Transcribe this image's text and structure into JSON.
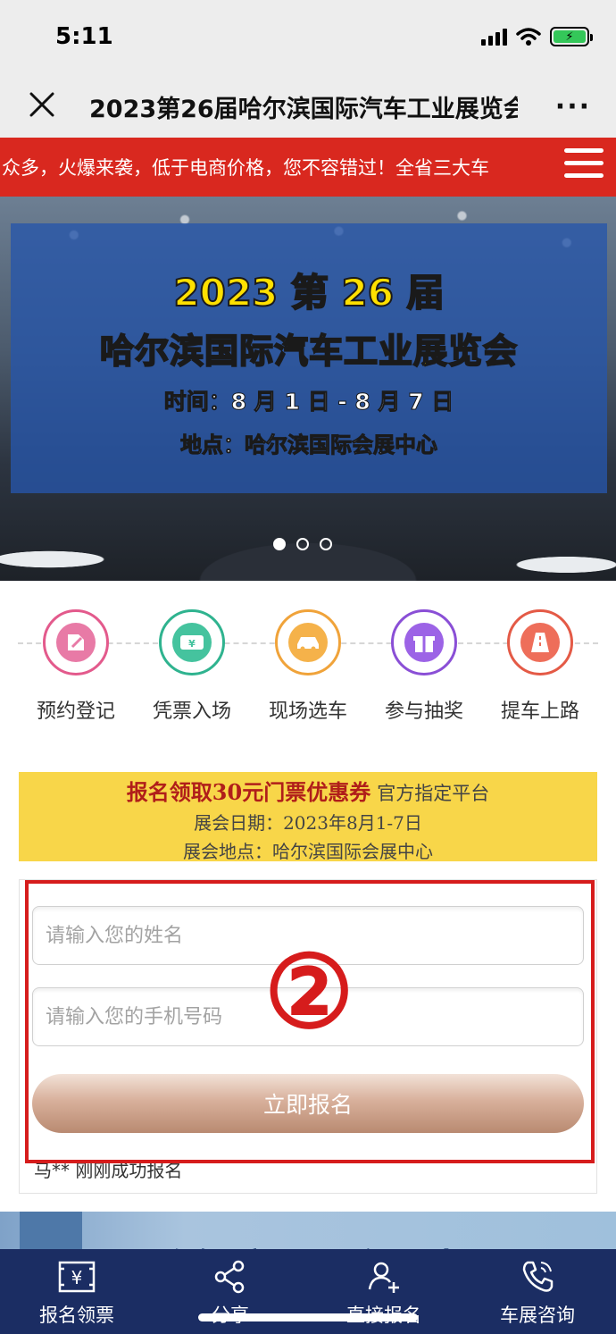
{
  "status_bar": {
    "time": "5:11",
    "battery_glyph": "⚡"
  },
  "nav": {
    "title": "2023第26届哈尔滨国际汽车工业展览会",
    "more_label": "···"
  },
  "ticker": {
    "text": "众多，火爆来袭，低于电商价格，您不容错过！全省三大车"
  },
  "banner": {
    "line1": "2023 第 26 届",
    "line2": "哈尔滨国际汽车工业展览会",
    "line3": "时间：8 月 1 日 - 8 月 7 日",
    "line4": "地点：哈尔滨国际会展中心",
    "active_slide": 1,
    "slide_count": 3
  },
  "steps": [
    {
      "label": "预约登记",
      "icon": "pen-tag-icon",
      "color": "#e35a8c",
      "inner": "#e87aa6"
    },
    {
      "label": "凭票入场",
      "icon": "ticket-icon",
      "color": "#2fb38f",
      "inner": "#45c39e"
    },
    {
      "label": "现场选车",
      "icon": "car-icon",
      "color": "#f0a33a",
      "inner": "#f5b24a"
    },
    {
      "label": "参与抽奖",
      "icon": "gift-icon",
      "color": "#8a4fd6",
      "inner": "#9c63e6"
    },
    {
      "label": "提车上路",
      "icon": "road-icon",
      "color": "#e45a46",
      "inner": "#ee6e5a"
    }
  ],
  "promo": {
    "highlight": "报名领取30元门票优惠券",
    "platform": "官方指定平台",
    "date_line": "展会日期：2023年8月1-7日",
    "venue_line": "展会地点：哈尔滨国际会展中心"
  },
  "form": {
    "name_placeholder": "请输入您的姓名",
    "phone_placeholder": "请输入您的手机号码",
    "submit_label": "立即报名",
    "recent_signup": "马** 刚刚成功报名",
    "annotation_mark": "②"
  },
  "lower_banner": {
    "text": "哈尔滨国际会展中心"
  },
  "bottom_tabs": [
    {
      "label": "报名领票",
      "icon": "ticket-yen-icon"
    },
    {
      "label": "分享",
      "icon": "share-icon"
    },
    {
      "label": "直接报名",
      "icon": "add-user-icon"
    },
    {
      "label": "车展咨询",
      "icon": "phone-icon"
    }
  ],
  "colors": {
    "ticker_red": "#d9281f",
    "promo_yellow": "#f8d649",
    "annotation_red": "#d61c1c",
    "bottom_bar_navy": "#1b2d63"
  }
}
